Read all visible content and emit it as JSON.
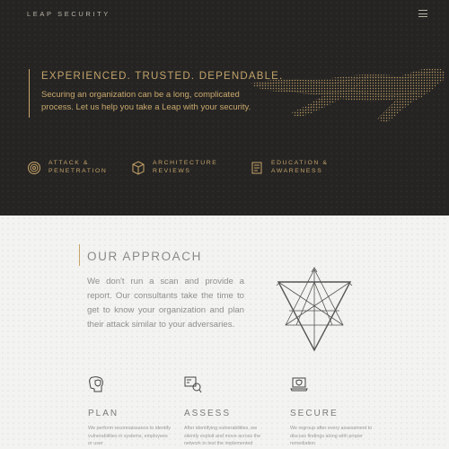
{
  "header": {
    "brand": "LEAP SECURITY",
    "menu_icon": "hamburger-menu-icon"
  },
  "hero": {
    "tagline": "EXPERIENCED. TRUSTED. DEPENDABLE.",
    "intro": "Securing an organization can be a long, complicated process. Let us help you take a Leap with your security.",
    "accent_color": "#c8a568",
    "background_color": "#252423"
  },
  "services": [
    {
      "label": "ATTACK & PENETRATION",
      "icon": "target-icon"
    },
    {
      "label": "ARCHITECTURE REVIEWS",
      "icon": "blocks-icon"
    },
    {
      "label": "EDUCATION & AWARENESS",
      "icon": "book-icon"
    }
  ],
  "approach": {
    "title": "OUR APPROACH",
    "text": "We don't run a scan and provide a report. Our consultants take the time to get to know your organization and plan their attack similar to your adversaries."
  },
  "columns": [
    {
      "title": "PLAN",
      "icon": "head-shield-icon",
      "text": "We perform reconnaissance to identify vulnerabilities in systems, employees or user"
    },
    {
      "title": "ASSESS",
      "icon": "magnifier-icon",
      "text": "After identifying vulnerabilities, we silently exploit and move across the network to test the implemented"
    },
    {
      "title": "SECURE",
      "icon": "laptop-shield-icon",
      "text": "We regroup after every assessment to discuss findings along with proper remediation"
    }
  ]
}
